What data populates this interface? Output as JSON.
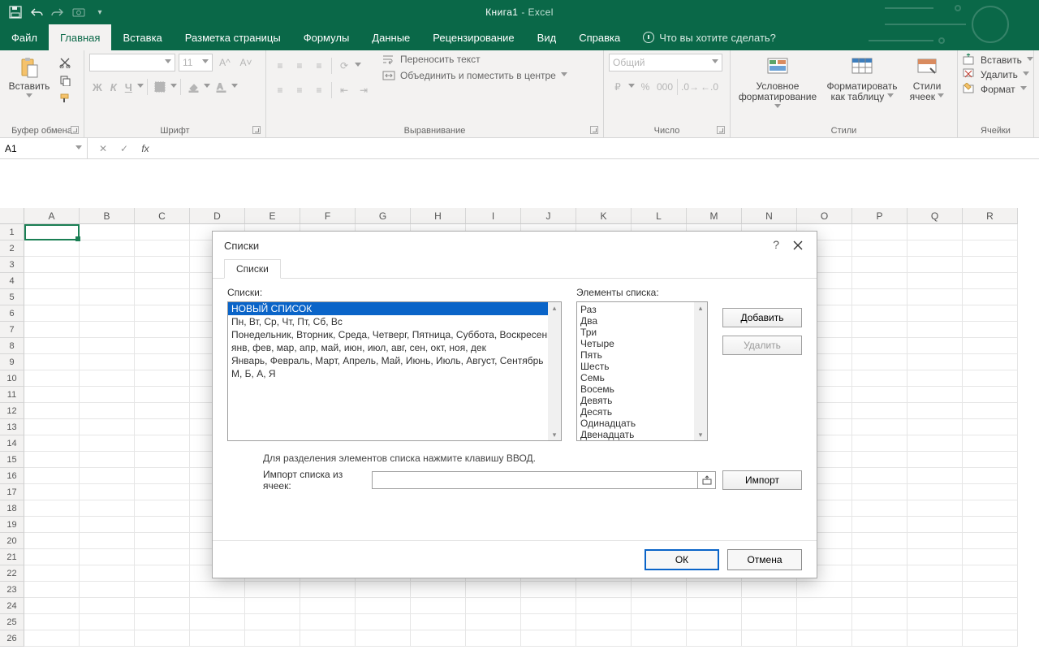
{
  "app": {
    "doc": "Книга1",
    "name": "- Excel"
  },
  "tabs": {
    "file": "Файл",
    "home": "Главная",
    "insert": "Вставка",
    "layout": "Разметка страницы",
    "formulas": "Формулы",
    "data": "Данные",
    "review": "Рецензирование",
    "view": "Вид",
    "help": "Справка",
    "tell": "Что вы хотите сделать?"
  },
  "ribbon": {
    "clipboard": {
      "paste": "Вставить",
      "group": "Буфер обмена"
    },
    "font": {
      "size": "11",
      "bold": "Ж",
      "italic": "К",
      "underline": "Ч",
      "group": "Шрифт"
    },
    "alignment": {
      "wrap": "Переносить текст",
      "merge": "Объединить и поместить в центре",
      "group": "Выравнивание"
    },
    "number": {
      "format": "Общий",
      "group": "Число"
    },
    "styles": {
      "cond": "Условное форматирование",
      "table": "Форматировать как таблицу",
      "cell": "Стили ячеек",
      "group": "Стили"
    },
    "cells": {
      "insert": "Вставить",
      "delete": "Удалить",
      "format": "Формат",
      "group": "Ячейки"
    }
  },
  "namebox": "A1",
  "columns": [
    "A",
    "B",
    "C",
    "D",
    "E",
    "F",
    "G",
    "H",
    "I",
    "J",
    "K",
    "L",
    "M",
    "N",
    "O",
    "P",
    "Q",
    "R"
  ],
  "rows": [
    "1",
    "2",
    "3",
    "4",
    "5",
    "6",
    "7",
    "8",
    "9",
    "10",
    "11",
    "12",
    "13",
    "14",
    "15",
    "16",
    "17",
    "18",
    "19",
    "20",
    "21",
    "22",
    "23",
    "24",
    "25",
    "26"
  ],
  "dialog": {
    "title": "Списки",
    "tab": "Списки",
    "lists_label": "Списки:",
    "entries_label": "Элементы списка:",
    "lists": [
      "НОВЫЙ СПИСОК",
      "Пн, Вт, Ср, Чт, Пт, Сб, Вс",
      "Понедельник, Вторник, Среда, Четверг, Пятница, Суббота, Воскресенье",
      "янв, фев, мар, апр, май, июн, июл, авг, сен, окт, ноя, дек",
      "Январь, Февраль, Март, Апрель, Май, Июнь, Июль, Август, Сентябрь",
      "М, Б, А, Я"
    ],
    "entries": "Раз\nДва\nТри\nЧетыре\nПять\nШесть\nСемь\nВосемь\nДевять\nДесять\nОдинадцать\nДвенадцать",
    "add": "Добавить",
    "delete": "Удалить",
    "hint": "Для разделения элементов списка нажмите клавишу ВВОД.",
    "import_label": "Импорт списка из ячеек:",
    "import": "Импорт",
    "ok": "ОК",
    "cancel": "Отмена"
  }
}
